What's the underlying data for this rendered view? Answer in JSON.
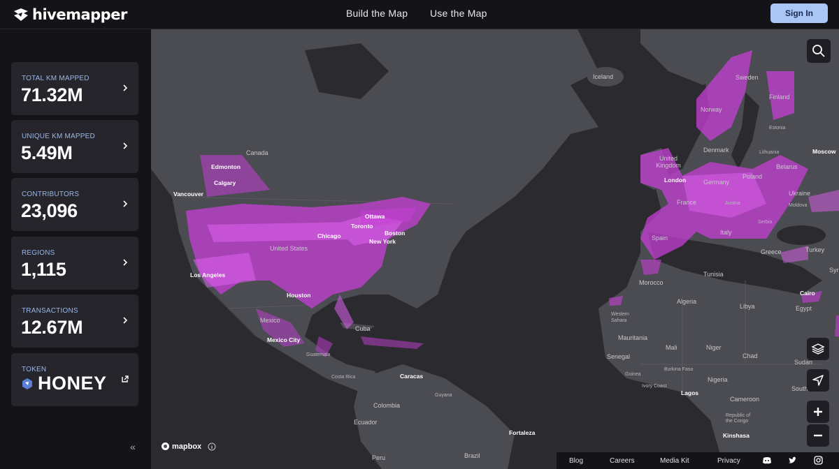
{
  "brand": {
    "name": "hivemapper"
  },
  "nav": {
    "build": "Build the Map",
    "use": "Use the Map",
    "signin": "Sign In"
  },
  "stats": [
    {
      "label": "TOTAL KM MAPPED",
      "value": "71.32M"
    },
    {
      "label": "UNIQUE KM MAPPED",
      "value": "5.49M"
    },
    {
      "label": "CONTRIBUTORS",
      "value": "23,096"
    },
    {
      "label": "REGIONS",
      "value": "1,115"
    },
    {
      "label": "TRANSACTIONS",
      "value": "12.67M"
    }
  ],
  "token": {
    "label": "TOKEN",
    "value": "HONEY"
  },
  "sidebar": {
    "collapse": "«"
  },
  "map": {
    "attribution": "mapbox",
    "places": {
      "iceland": "Iceland",
      "sweden": "Sweden",
      "finland": "Finland",
      "norway": "Norway",
      "estonia": "Estonia",
      "denmark": "Denmark",
      "lithuania": "Lithuania",
      "moscow": "Moscow",
      "united_kingdom": "United Kingdom",
      "belarus": "Belarus",
      "london": "London",
      "germany": "Germany",
      "poland": "Poland",
      "ukraine": "Ukraine",
      "france": "France",
      "austria": "Austria",
      "moldova": "Moldova",
      "serbia": "Serbia",
      "italy": "Italy",
      "spain": "Spain",
      "greece": "Greece",
      "turkey": "Turkey",
      "syria": "Syria",
      "morocco": "Morocco",
      "tunisia": "Tunisia",
      "cairo": "Cairo",
      "algeria": "Algeria",
      "libya": "Libya",
      "egypt": "Egypt",
      "western_sahara": "Western Sahara",
      "mauritania": "Mauritania",
      "mali": "Mali",
      "niger": "Niger",
      "chad": "Chad",
      "sudan": "Sudan",
      "senegal": "Senegal",
      "burkina_faso": "Burkina Faso",
      "guinea": "Guinea",
      "ivory_coast": "Ivory Coast",
      "nigeria": "Nigeria",
      "south_sudan": "South Suda",
      "lagos": "Lagos",
      "cameroon": "Cameroon",
      "congo": "Republic of the Congo",
      "kinshasa": "Kinshasa",
      "canada": "Canada",
      "edmonton": "Edmonton",
      "calgary": "Calgary",
      "vancouver": "Vancouver",
      "ottawa": "Ottawa",
      "toronto": "Toronto",
      "chicago": "Chicago",
      "boston": "Boston",
      "new_york": "New York",
      "united_states": "United States",
      "los_angeles": "Los Angeles",
      "houston": "Houston",
      "mexico": "Mexico",
      "cuba": "Cuba",
      "mexico_city": "Mexico City",
      "guatemala": "Guatemala",
      "caracas": "Caracas",
      "costa_rica": "Costa Rica",
      "guyana": "Guyana",
      "colombia": "Colombia",
      "ecuador": "Ecuador",
      "fortaleza": "Fortaleza",
      "brazil": "Brazil",
      "peru": "Peru"
    }
  },
  "footer": {
    "blog": "Blog",
    "careers": "Careers",
    "media_kit": "Media Kit",
    "privacy": "Privacy"
  },
  "colors": {
    "accent": "#a9c6f5",
    "coverage": "#c63fd6",
    "card": "#25252b",
    "label": "#9ab8e8"
  }
}
